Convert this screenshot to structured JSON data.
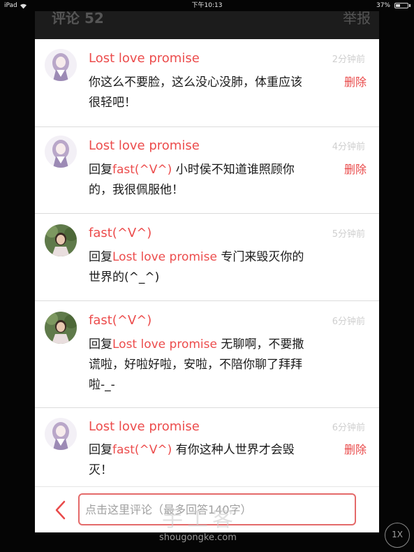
{
  "status_bar": {
    "device": "iPad",
    "time": "下午10:13",
    "battery_percent": "37%",
    "battery_level": 0.37
  },
  "header": {
    "title": "评论 52",
    "right_label": "举报"
  },
  "comments": [
    {
      "author": "Lost love promise",
      "time": "2分钟前",
      "reply_prefix": "",
      "reply_to": "",
      "text": "你这么不要脸，这么没心没肺，体重应该很轻吧！",
      "delete_label": "删除",
      "avatar": "anime-girl-avatar"
    },
    {
      "author": "Lost love promise",
      "time": "4分钟前",
      "reply_prefix": "回复",
      "reply_to": "fast(^V^)",
      "text": " 小时侯不知道谁照顾你的，我很佩服他！",
      "delete_label": "删除",
      "avatar": "anime-girl-avatar"
    },
    {
      "author": "fast(^V^)",
      "time": "5分钟前",
      "reply_prefix": "回复",
      "reply_to": "Lost love promise",
      "text": " 专门来毁灭你的世界的(^_^)",
      "delete_label": "",
      "avatar": "photo-girl-avatar"
    },
    {
      "author": "fast(^V^)",
      "time": "6分钟前",
      "reply_prefix": "回复",
      "reply_to": "Lost love promise",
      "text": " 无聊啊，不要撒谎啦，好啦好啦，安啦，不陪你聊了拜拜啦-_-",
      "delete_label": "",
      "avatar": "photo-girl-avatar"
    },
    {
      "author": "Lost love promise",
      "time": "6分钟前",
      "reply_prefix": "回复",
      "reply_to": "fast(^V^)",
      "text": " 有你这种人世界才会毁灭！",
      "delete_label": "删除",
      "avatar": "anime-girl-avatar"
    }
  ],
  "input_bar": {
    "placeholder": "点击这里评论（最多回答140字）",
    "back_icon": "chevron-left-icon"
  },
  "watermark": {
    "logo": "手工客",
    "url": "shougongke.com"
  },
  "zoom_button": {
    "label": "1X"
  },
  "colors": {
    "accent": "#ec4c4c",
    "header_bg": "#1c1c1c",
    "page_bg": "#050505",
    "divider": "#dcdcdc",
    "time_text": "#cfcfcf"
  }
}
